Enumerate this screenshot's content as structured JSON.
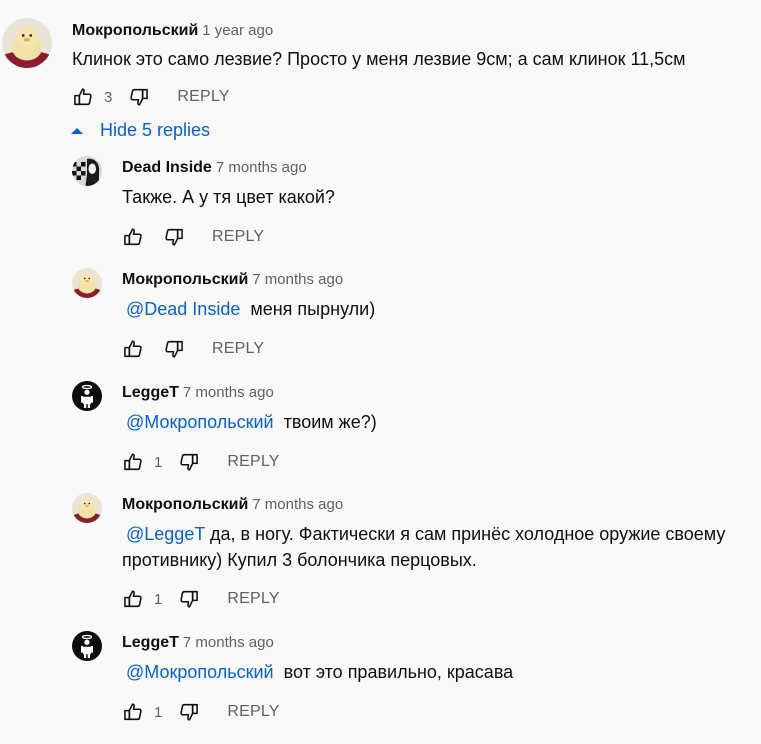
{
  "top": {
    "author": "Мокропольский",
    "time": "1 year ago",
    "text": "Клинок это само лезвие? Просто у меня лезвие 9см; а сам клинок 11,5см",
    "likes": "3",
    "reply_label": "REPLY"
  },
  "toggle_label": "Hide 5 replies",
  "replies": [
    {
      "author": "Dead Inside",
      "time": "7 months ago",
      "mention": "",
      "text": "Также. А у тя цвет какой?",
      "text2": "",
      "likes": "",
      "reply_label": "REPLY"
    },
    {
      "author": "Мокропольский",
      "time": "7 months ago",
      "mention": "@Dead Inside",
      "text": "меня пырнули)",
      "text2": "",
      "likes": "",
      "reply_label": "REPLY"
    },
    {
      "author": "LeggeT",
      "time": "7 months ago",
      "mention": "@Мокропольский",
      "text": "твоим же?)",
      "text2": "",
      "likes": "1",
      "reply_label": "REPLY"
    },
    {
      "author": "Мокропольский",
      "time": "7 months ago",
      "mention": "@LeggeT",
      "text": "да, в ногу. Фактически я сам принёс холодное оружие своему",
      "text2": "противнику) Купил 3 болончика перцовых.",
      "likes": "1",
      "reply_label": "REPLY"
    },
    {
      "author": "LeggeT",
      "time": "7 months ago",
      "mention": "@Мокропольский",
      "text": "вот это правильно, красава",
      "text2": "",
      "likes": "1",
      "reply_label": "REPLY"
    }
  ],
  "icons": {
    "like": "thumbs-up-icon",
    "dislike": "thumbs-down-icon",
    "toggle": "caret-up-icon"
  },
  "colors": {
    "mention": "#065fd4",
    "secondary_text": "#606060",
    "background": "#f9f9f9"
  }
}
